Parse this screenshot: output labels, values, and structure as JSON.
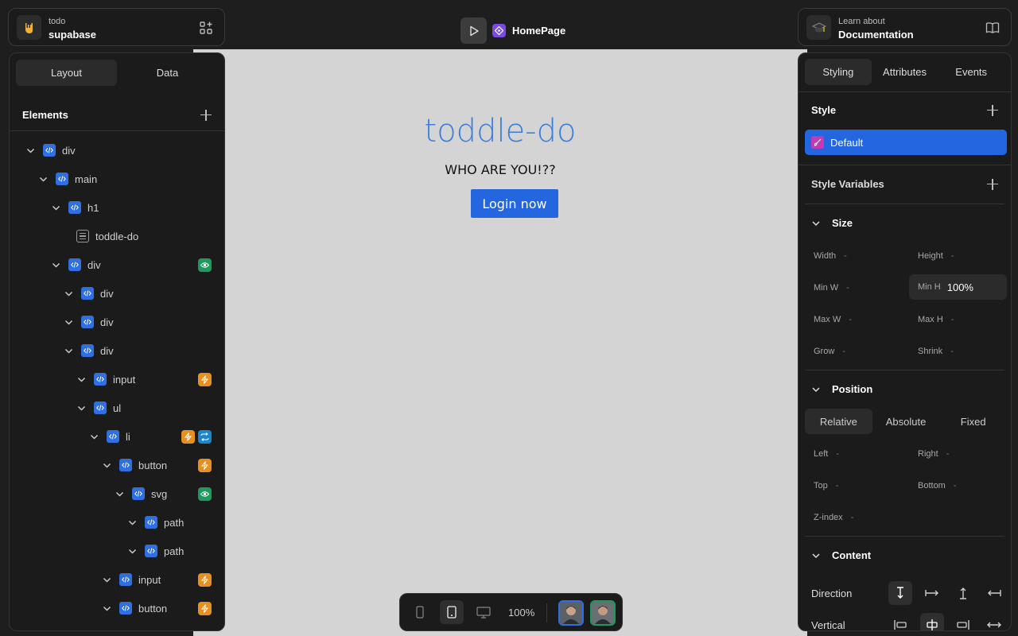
{
  "project": {
    "org": "todo",
    "name": "supabase"
  },
  "page": {
    "name": "HomePage"
  },
  "docs": {
    "kicker": "Learn about",
    "title": "Documentation"
  },
  "canvas": {
    "title": "toddle-do",
    "subtitle": "WHO ARE YOU!??",
    "button": "Login now"
  },
  "left_panel": {
    "tabs": [
      "Layout",
      "Data"
    ],
    "elements_title": "Elements",
    "tree": [
      {
        "label": "div",
        "type": "code",
        "badges": []
      },
      {
        "label": "main",
        "type": "code",
        "badges": []
      },
      {
        "label": "h1",
        "type": "code",
        "badges": []
      },
      {
        "label": "toddle-do",
        "type": "text",
        "badges": []
      },
      {
        "label": "div",
        "type": "code",
        "badges": [
          "eye"
        ]
      },
      {
        "label": "div",
        "type": "code",
        "badges": []
      },
      {
        "label": "div",
        "type": "code",
        "badges": []
      },
      {
        "label": "div",
        "type": "code",
        "badges": []
      },
      {
        "label": "input",
        "type": "code",
        "badges": [
          "bolt"
        ]
      },
      {
        "label": "ul",
        "type": "code",
        "badges": []
      },
      {
        "label": "li",
        "type": "code",
        "badges": [
          "bolt",
          "repeat"
        ]
      },
      {
        "label": "button",
        "type": "code",
        "badges": [
          "bolt"
        ]
      },
      {
        "label": "svg",
        "type": "code",
        "badges": [
          "eye"
        ]
      },
      {
        "label": "path",
        "type": "code",
        "badges": []
      },
      {
        "label": "path",
        "type": "code",
        "badges": []
      },
      {
        "label": "input",
        "type": "code",
        "badges": [
          "bolt"
        ]
      },
      {
        "label": "button",
        "type": "code",
        "badges": [
          "bolt"
        ]
      }
    ]
  },
  "toolbar": {
    "zoom": "100%"
  },
  "right_panel": {
    "tabs": [
      "Styling",
      "Attributes",
      "Events"
    ],
    "style_title": "Style",
    "style_default": "Default",
    "style_variables": "Style Variables",
    "size": {
      "title": "Size",
      "width": "Width",
      "height": "Height",
      "min_w": "Min W",
      "min_h": "Min H",
      "min_h_value": "100%",
      "max_w": "Max W",
      "max_h": "Max H",
      "grow": "Grow",
      "shrink": "Shrink",
      "dash": "-"
    },
    "position": {
      "title": "Position",
      "modes": [
        "Relative",
        "Absolute",
        "Fixed"
      ],
      "left": "Left",
      "right": "Right",
      "top": "Top",
      "bottom": "Bottom",
      "z_index": "Z-index"
    },
    "content": {
      "title": "Content",
      "direction": "Direction",
      "vertical": "Vertical"
    }
  }
}
